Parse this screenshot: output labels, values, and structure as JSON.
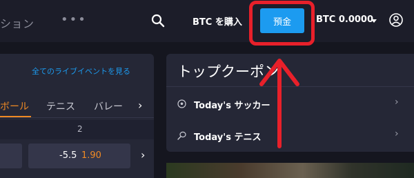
{
  "header": {
    "nav_partial": "ション",
    "nav_more": "•••",
    "buy_btc_label": "BTC を購入",
    "deposit_label": "預金",
    "balance_label": "BTC 0.0000"
  },
  "live_panel": {
    "all_live_events_link": "全てのライブイベントを見る",
    "tabs": [
      {
        "label": "ボール",
        "active": true
      },
      {
        "label": "テニス",
        "active": false
      },
      {
        "label": "バレー",
        "active": false
      }
    ],
    "column_header": "2",
    "odds": {
      "handicap": "-5.5",
      "price": "1.90"
    }
  },
  "coupons": {
    "title": "トップクーポン",
    "items": [
      {
        "label": "Today's サッカー",
        "icon": "soccer-ball-icon"
      },
      {
        "label": "Today's テニス",
        "icon": "tennis-racket-icon"
      }
    ]
  },
  "colors": {
    "accent": "#1c9bf0",
    "odds_price": "#f08a24",
    "annotation": "#e8202a"
  }
}
